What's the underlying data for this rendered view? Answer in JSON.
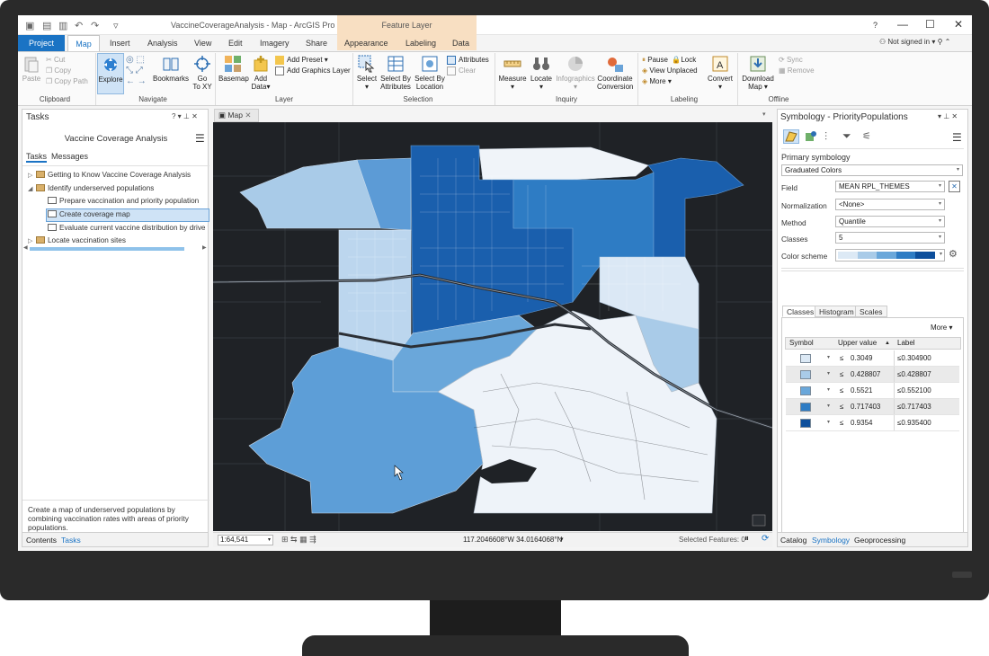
{
  "app": {
    "title": "VaccineCoverageAnalysis - Map - ArcGIS Pro",
    "contextual_tab_group": "Feature Layer",
    "help": "?",
    "signin": "Not signed in"
  },
  "ribbon": {
    "tabs": [
      "Project",
      "Map",
      "Insert",
      "Analysis",
      "View",
      "Edit",
      "Imagery",
      "Share",
      "Appearance",
      "Labeling",
      "Data"
    ],
    "active_tab": "Map",
    "groups": [
      "Clipboard",
      "Navigate",
      "Layer",
      "Selection",
      "Inquiry",
      "Labeling",
      "Offline"
    ],
    "clipboard": {
      "paste": "Paste",
      "cut": "Cut",
      "copy": "Copy",
      "copy_path": "Copy Path"
    },
    "navigate": {
      "explore": "Explore",
      "bookmarks": "Bookmarks",
      "goto_line1": "Go",
      "goto_line2": "To XY"
    },
    "layer": {
      "basemap": "Basemap",
      "add_data_line1": "Add",
      "add_data_line2": "Data",
      "add_preset": "Add Preset",
      "add_graphics": "Add Graphics Layer"
    },
    "selection": {
      "select": "Select",
      "select_attr_line1": "Select By",
      "select_attr_line2": "Attributes",
      "select_loc_line1": "Select By",
      "select_loc_line2": "Location",
      "attributes": "Attributes",
      "clear": "Clear"
    },
    "inquiry": {
      "measure": "Measure",
      "locate": "Locate",
      "infographics": "Infographics",
      "coord_line1": "Coordinate",
      "coord_line2": "Conversion"
    },
    "labeling": {
      "pause": "Pause",
      "lock": "Lock",
      "view_unplaced": "View Unplaced",
      "more": "More",
      "convert": "Convert"
    },
    "offline": {
      "download_line1": "Download",
      "download_line2": "Map",
      "sync": "Sync",
      "remove": "Remove"
    }
  },
  "tasks_pane": {
    "title": "Tasks",
    "controls": "?  ▾  ⊥  ✕",
    "subtitle": "Vaccine Coverage Analysis",
    "tabs": [
      "Tasks",
      "Messages"
    ],
    "items": [
      "Getting to Know Vaccine Coverage Analysis",
      "Identify underserved populations",
      "Prepare vaccination and priority population",
      "Create coverage map",
      "Evaluate current vaccine distribution by drive time",
      "Locate vaccination sites"
    ],
    "description": "Create a map of underserved populations by combining vaccination rates with areas of priority populations.",
    "bottom_tabs": [
      "Contents",
      "Tasks"
    ]
  },
  "map": {
    "tab_label": "Map",
    "scale": "1:64,541",
    "coordinates": "117.2046608°W 34.0164068°N",
    "selected_features": "Selected Features: 0"
  },
  "symbology": {
    "title": "Symbology - PriorityPopulations",
    "primary": "Primary symbology",
    "method_type": "Graduated Colors",
    "field_label": "Field",
    "field_value": "MEAN RPL_THEMES",
    "normalization_label": "Normalization",
    "normalization_value": "<None>",
    "method_label": "Method",
    "method_value": "Quantile",
    "classes_label": "Classes",
    "classes_value": "5",
    "scheme_label": "Color scheme",
    "subtabs": [
      "Classes",
      "Histogram",
      "Scales"
    ],
    "more": "More",
    "columns": [
      "Symbol",
      "Upper value",
      "Label"
    ],
    "rows": [
      {
        "op": "≤",
        "upper": "0.3049",
        "label": "≤0.304900",
        "color": "#dce9f5"
      },
      {
        "op": "≤",
        "upper": "0.428807",
        "label": "≤0.428807",
        "color": "#a9cbe8"
      },
      {
        "op": "≤",
        "upper": "0.5521",
        "label": "≤0.552100",
        "color": "#6aa7da"
      },
      {
        "op": "≤",
        "upper": "0.717403",
        "label": "≤0.717403",
        "color": "#2e7cc4"
      },
      {
        "op": "≤",
        "upper": "0.9354",
        "label": "≤0.935400",
        "color": "#0d4f9c"
      }
    ],
    "bottom_tabs": [
      "Catalog",
      "Symbology",
      "Geoprocessing"
    ]
  },
  "colors": {
    "accent": "#1a73c4",
    "monitor": "#2a2a2a",
    "map_bg": "#1f2226"
  }
}
